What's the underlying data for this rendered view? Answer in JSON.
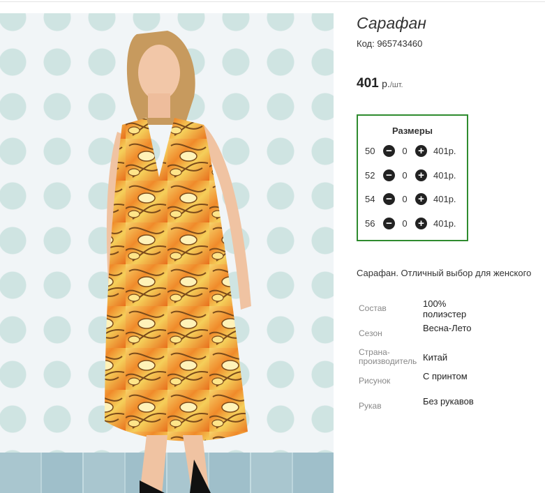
{
  "product": {
    "title": "Сарафан",
    "sku": "Код: 965743460",
    "price": "401",
    "currency": "р.",
    "unit": "/шт.",
    "description": "Сарафан. Отличный выбор для женского"
  },
  "sizes": {
    "header": "Размеры",
    "rows": [
      {
        "size": "50",
        "qty": "0",
        "price": "401р."
      },
      {
        "size": "52",
        "qty": "0",
        "price": "401р."
      },
      {
        "size": "54",
        "qty": "0",
        "price": "401р."
      },
      {
        "size": "56",
        "qty": "0",
        "price": "401р."
      }
    ],
    "minus_icon": "minus-circle-icon",
    "plus_icon": "plus-circle-icon",
    "border_color": "#2e8b2e"
  },
  "attributes": [
    {
      "key": "Состав",
      "value": "100% полиэстер"
    },
    {
      "key": "Сезон",
      "value": "Весна-Лето"
    },
    {
      "key": "Страна-производитель",
      "value": "Китай"
    },
    {
      "key": "Рисунок",
      "value": "С принтом"
    },
    {
      "key": "Рукав",
      "value": "Без рукавов"
    }
  ]
}
